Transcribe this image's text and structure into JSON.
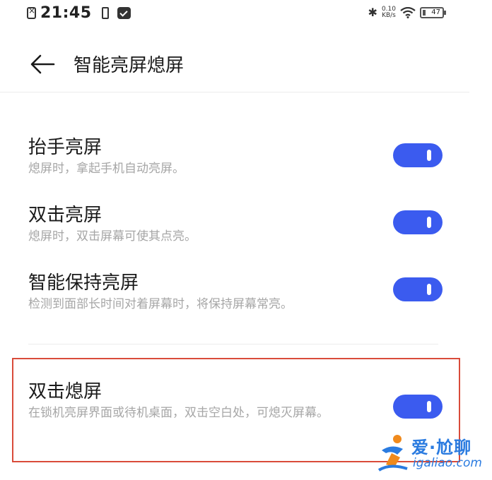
{
  "status_bar": {
    "time": "21:45",
    "net_speed_value": "0.10",
    "net_speed_unit": "KB/s",
    "battery": "47"
  },
  "header": {
    "title": "智能亮屏熄屏"
  },
  "settings": [
    {
      "title": "抬手亮屏",
      "desc": "熄屏时，拿起手机自动亮屏。",
      "enabled": true
    },
    {
      "title": "双击亮屏",
      "desc": "熄屏时，双击屏幕可使其点亮。",
      "enabled": true
    },
    {
      "title": "智能保持亮屏",
      "desc": "检测到面部长时间对着屏幕时，将保持屏幕常亮。",
      "enabled": true
    },
    {
      "title": "双击熄屏",
      "desc": "在锁机亮屏界面或待机桌面，双击空白处，可熄灭屏幕。",
      "enabled": true
    }
  ],
  "watermark": {
    "brand": "爱·尬聊",
    "url": "igaliao.com"
  },
  "colors": {
    "toggle_on": "#3b5bef",
    "highlight_border": "#d94b3a",
    "watermark": "#2a7be0"
  }
}
